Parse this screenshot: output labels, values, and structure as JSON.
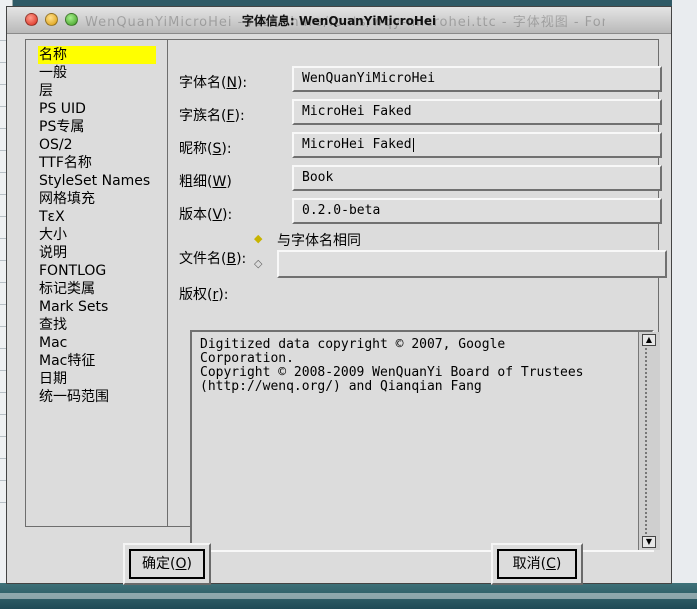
{
  "window": {
    "title": "字体信息: WenQuanYiMicroHei",
    "behind_title": "WenQuanYiMicroHei - /usr/share/fonts/wqy-microhei.ttc - 字体视图 - FontForge"
  },
  "nav": {
    "items": [
      {
        "label": "名称",
        "selected": true
      },
      {
        "label": "一般"
      },
      {
        "label": "层"
      },
      {
        "label": "PS UID"
      },
      {
        "label": "PS专属"
      },
      {
        "label": "OS/2"
      },
      {
        "label": "TTF名称"
      },
      {
        "label": "StyleSet Names"
      },
      {
        "label": "网格填充"
      },
      {
        "label": "TεX"
      },
      {
        "label": "大小"
      },
      {
        "label": "说明"
      },
      {
        "label": "FONTLOG"
      },
      {
        "label": "标记类属"
      },
      {
        "label": "Mark Sets"
      },
      {
        "label": "查找"
      },
      {
        "label": "Mac"
      },
      {
        "label": "Mac特征"
      },
      {
        "label": "日期"
      },
      {
        "label": "统一码范围"
      }
    ]
  },
  "form": {
    "fontname": {
      "label_pre": "字体名(",
      "key": "N",
      "label_post": "):",
      "value": "WenQuanYiMicroHei"
    },
    "family": {
      "label_pre": "字族名(",
      "key": "F",
      "label_post": "):",
      "value": "MicroHei Faked"
    },
    "nickname": {
      "label_pre": "昵称(",
      "key": "S",
      "label_post": "):",
      "value": "MicroHei Faked"
    },
    "weight": {
      "label_pre": "粗细(",
      "key": "W",
      "label_post": ")",
      "value": "Book"
    },
    "version": {
      "label_pre": "版本(",
      "key": "V",
      "label_post": "):",
      "value": "0.2.0-beta"
    },
    "filename": {
      "label_pre": "文件名(",
      "key": "B",
      "label_post": "):",
      "same_as_fontname_label": "与字体名相同",
      "value": ""
    },
    "copyright": {
      "label_pre": "版权(",
      "key": "r",
      "label_post": "):",
      "lines": [
        "Digitized data copyright © 2007, Google",
        "Corporation.",
        "Copyright © 2008-2009 WenQuanYi Board of Trustees",
        "(http://wenq.org/) and Qianqian Fang"
      ]
    }
  },
  "buttons": {
    "ok": {
      "label_pre": "确定(",
      "key": "O",
      "label_post": ")"
    },
    "cancel": {
      "label_pre": "取消(",
      "key": "C",
      "label_post": ")"
    }
  },
  "colors": {
    "selected_bg": "#ffff00",
    "radio_on": "#c8b400"
  }
}
